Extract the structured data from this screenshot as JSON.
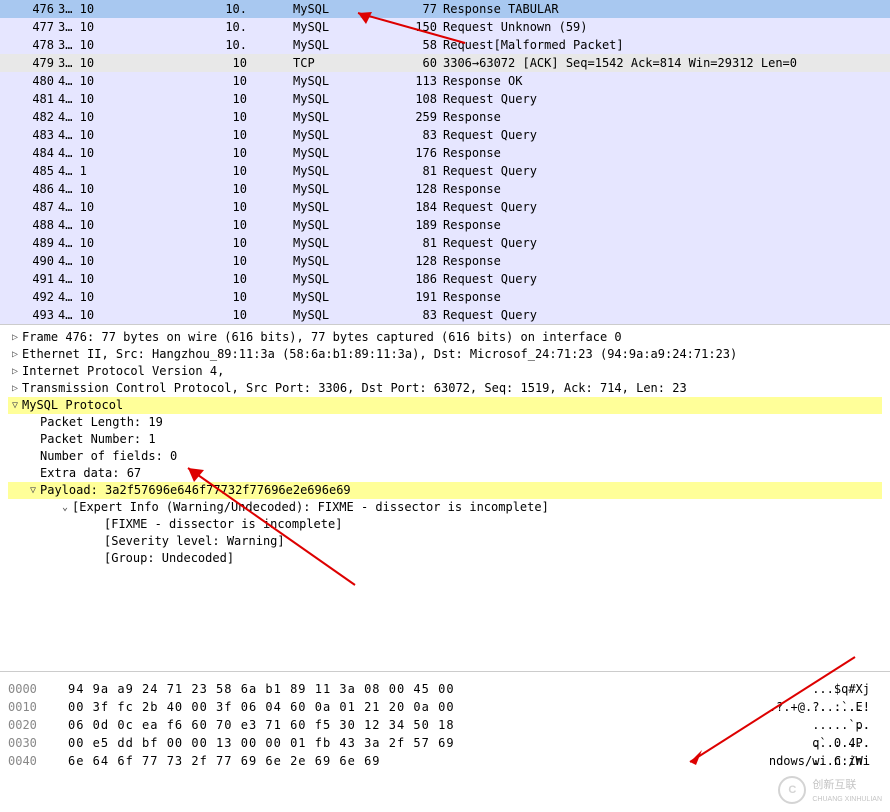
{
  "packets": [
    {
      "no": "476",
      "t": "3…",
      "t2": "10",
      "ln": "10.",
      "proto": "MySQL",
      "len": "77",
      "info": "Response  TABULAR",
      "sel": true,
      "cls": "mysql"
    },
    {
      "no": "477",
      "t": "3…",
      "t2": "10",
      "ln": "10.",
      "proto": "MySQL",
      "len": "150",
      "info": "Request  Unknown (59)",
      "cls": "mysql"
    },
    {
      "no": "478",
      "t": "3…",
      "t2": "10",
      "ln": "10.",
      "proto": "MySQL",
      "len": "58",
      "info": "Request[Malformed Packet]",
      "cls": "mysql"
    },
    {
      "no": "479",
      "t": "3…",
      "t2": "10",
      "ln": "10",
      "proto": "TCP",
      "len": "60",
      "info": "3306→63072 [ACK] Seq=1542 Ack=814 Win=29312 Len=0",
      "cls": "tcp"
    },
    {
      "no": "480",
      "t": "4…",
      "t2": "10",
      "ln": "10",
      "proto": "MySQL",
      "len": "113",
      "info": "Response OK",
      "cls": "mysql"
    },
    {
      "no": "481",
      "t": "4…",
      "t2": "10",
      "ln": "10",
      "proto": "MySQL",
      "len": "108",
      "info": "Request Query",
      "cls": "mysql"
    },
    {
      "no": "482",
      "t": "4…",
      "t2": "10",
      "ln": "10",
      "proto": "MySQL",
      "len": "259",
      "info": "Response",
      "cls": "mysql"
    },
    {
      "no": "483",
      "t": "4…",
      "t2": "10",
      "ln": "10",
      "proto": "MySQL",
      "len": "83",
      "info": "Request Query",
      "cls": "mysql"
    },
    {
      "no": "484",
      "t": "4…",
      "t2": "10",
      "ln": "10",
      "proto": "MySQL",
      "len": "176",
      "info": "Response",
      "cls": "mysql"
    },
    {
      "no": "485",
      "t": "4…",
      "t2": "1",
      "ln": "10",
      "proto": "MySQL",
      "len": "81",
      "info": "Request Query",
      "cls": "mysql"
    },
    {
      "no": "486",
      "t": "4…",
      "t2": "10",
      "ln": "10",
      "proto": "MySQL",
      "len": "128",
      "info": "Response",
      "cls": "mysql"
    },
    {
      "no": "487",
      "t": "4…",
      "t2": "10",
      "ln": "10",
      "proto": "MySQL",
      "len": "184",
      "info": "Request Query",
      "cls": "mysql"
    },
    {
      "no": "488",
      "t": "4…",
      "t2": "10",
      "ln": "10",
      "proto": "MySQL",
      "len": "189",
      "info": "Response",
      "cls": "mysql"
    },
    {
      "no": "489",
      "t": "4…",
      "t2": "10",
      "ln": "10",
      "proto": "MySQL",
      "len": "81",
      "info": "Request Query",
      "cls": "mysql"
    },
    {
      "no": "490",
      "t": "4…",
      "t2": "10",
      "ln": "10",
      "proto": "MySQL",
      "len": "128",
      "info": "Response",
      "cls": "mysql"
    },
    {
      "no": "491",
      "t": "4…",
      "t2": "10",
      "ln": "10",
      "proto": "MySQL",
      "len": "186",
      "info": "Request Query",
      "cls": "mysql"
    },
    {
      "no": "492",
      "t": "4…",
      "t2": "10",
      "ln": "10",
      "proto": "MySQL",
      "len": "191",
      "info": "Response",
      "cls": "mysql"
    },
    {
      "no": "493",
      "t": "4…",
      "t2": "10",
      "ln": "10",
      "proto": "MySQL",
      "len": "83",
      "info": "Request Query",
      "cls": "mysql"
    }
  ],
  "tree": {
    "frame": "Frame 476: 77 bytes on wire (616 bits), 77 bytes captured (616 bits) on interface 0",
    "eth": "Ethernet II, Src: Hangzhou_89:11:3a (58:6a:b1:89:11:3a), Dst: Microsof_24:71:23 (94:9a:a9:24:71:23)",
    "ip": "Internet Protocol Version 4,",
    "tcp": "Transmission Control Protocol, Src Port: 3306, Dst Port: 63072, Seq: 1519, Ack: 714, Len: 23",
    "mysql": "MySQL Protocol",
    "pktlen": "Packet Length: 19",
    "pktnum": "Packet Number: 1",
    "nfields": "Number of fields: 0",
    "extra": "Extra data: 67",
    "payload": "Payload: 3a2f57696e646f77732f77696e2e696e69",
    "expert": "[Expert Info (Warning/Undecoded): FIXME - dissector is incomplete]",
    "fixme": "[FIXME - dissector is incomplete]",
    "sev": "[Severity level: Warning]",
    "group": "[Group: Undecoded]"
  },
  "hex": [
    {
      "off": "0000",
      "b": "94 9a a9 24 71 23 58 6a  b1 89 11 3a 08 00 45 00",
      "asc": "...$q#Xj ...:..E."
    },
    {
      "off": "0010",
      "b": "00 3f fc 2b 40 00 3f 06  04 60 0a 01 21 20 0a 00",
      "asc": ".?.+@.?. .`..! .."
    },
    {
      "off": "0020",
      "b": "06 0d 0c ea f6 60 70 e3  71 60 f5 30 12 34 50 18",
      "asc": ".....`p. q`.0.4P."
    },
    {
      "off": "0030",
      "b": "00 e5 dd bf 00 00 13 00  00 01 fb 43 3a 2f 57 69",
      "asc": "........ ...C:/Wi"
    },
    {
      "off": "0040",
      "b": "6e 64 6f 77 73 2f 77 69  6e 2e 69 6e 69",
      "asc": "ndows/wi n.ini"
    }
  ],
  "logo": {
    "text": "创新互联",
    "sub": "CHUANG XINHULIAN"
  }
}
